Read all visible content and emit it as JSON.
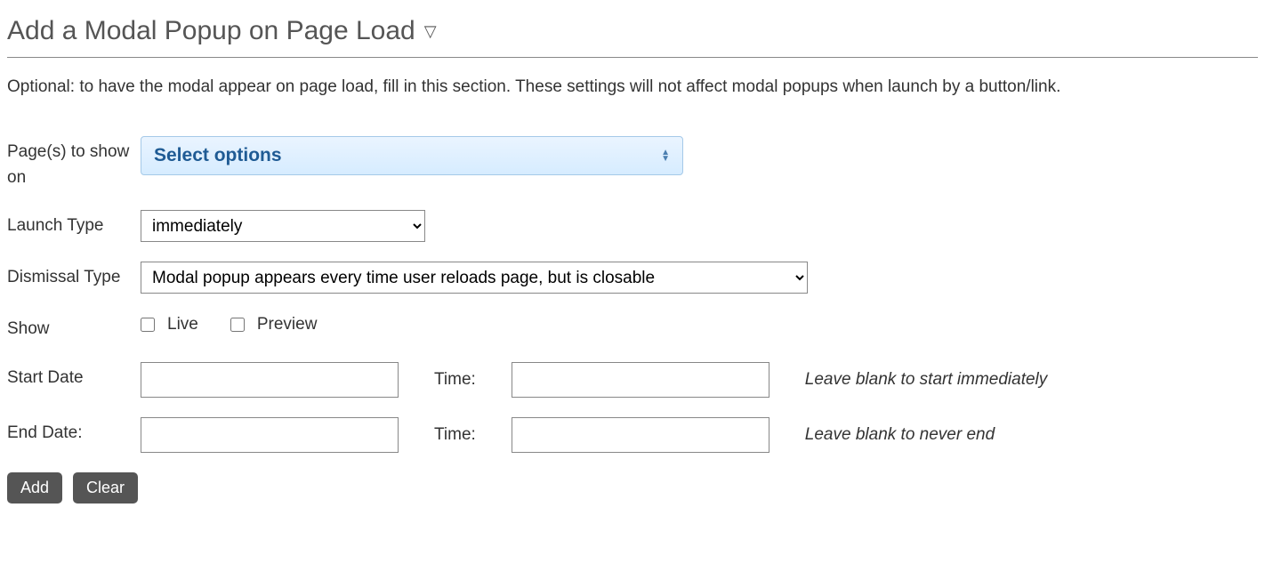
{
  "heading": "Add a Modal Popup on Page Load",
  "description": "Optional: to have the modal appear on page load, fill in this section. These settings will not affect modal popups when launch by a button/link.",
  "fields": {
    "pages_label": "Page(s) to show on",
    "pages_placeholder": "Select options",
    "launch_label": "Launch Type",
    "launch_value": "immediately",
    "dismissal_label": "Dismissal Type",
    "dismissal_value": "Modal popup appears every time user reloads page, but is closable",
    "show_label": "Show",
    "show_live": "Live",
    "show_preview": "Preview",
    "start_date_label": "Start Date",
    "time_label": "Time:",
    "start_hint": "Leave blank to start immediately",
    "end_date_label": "End Date:",
    "end_hint": "Leave blank to never end"
  },
  "buttons": {
    "add": "Add",
    "clear": "Clear"
  }
}
